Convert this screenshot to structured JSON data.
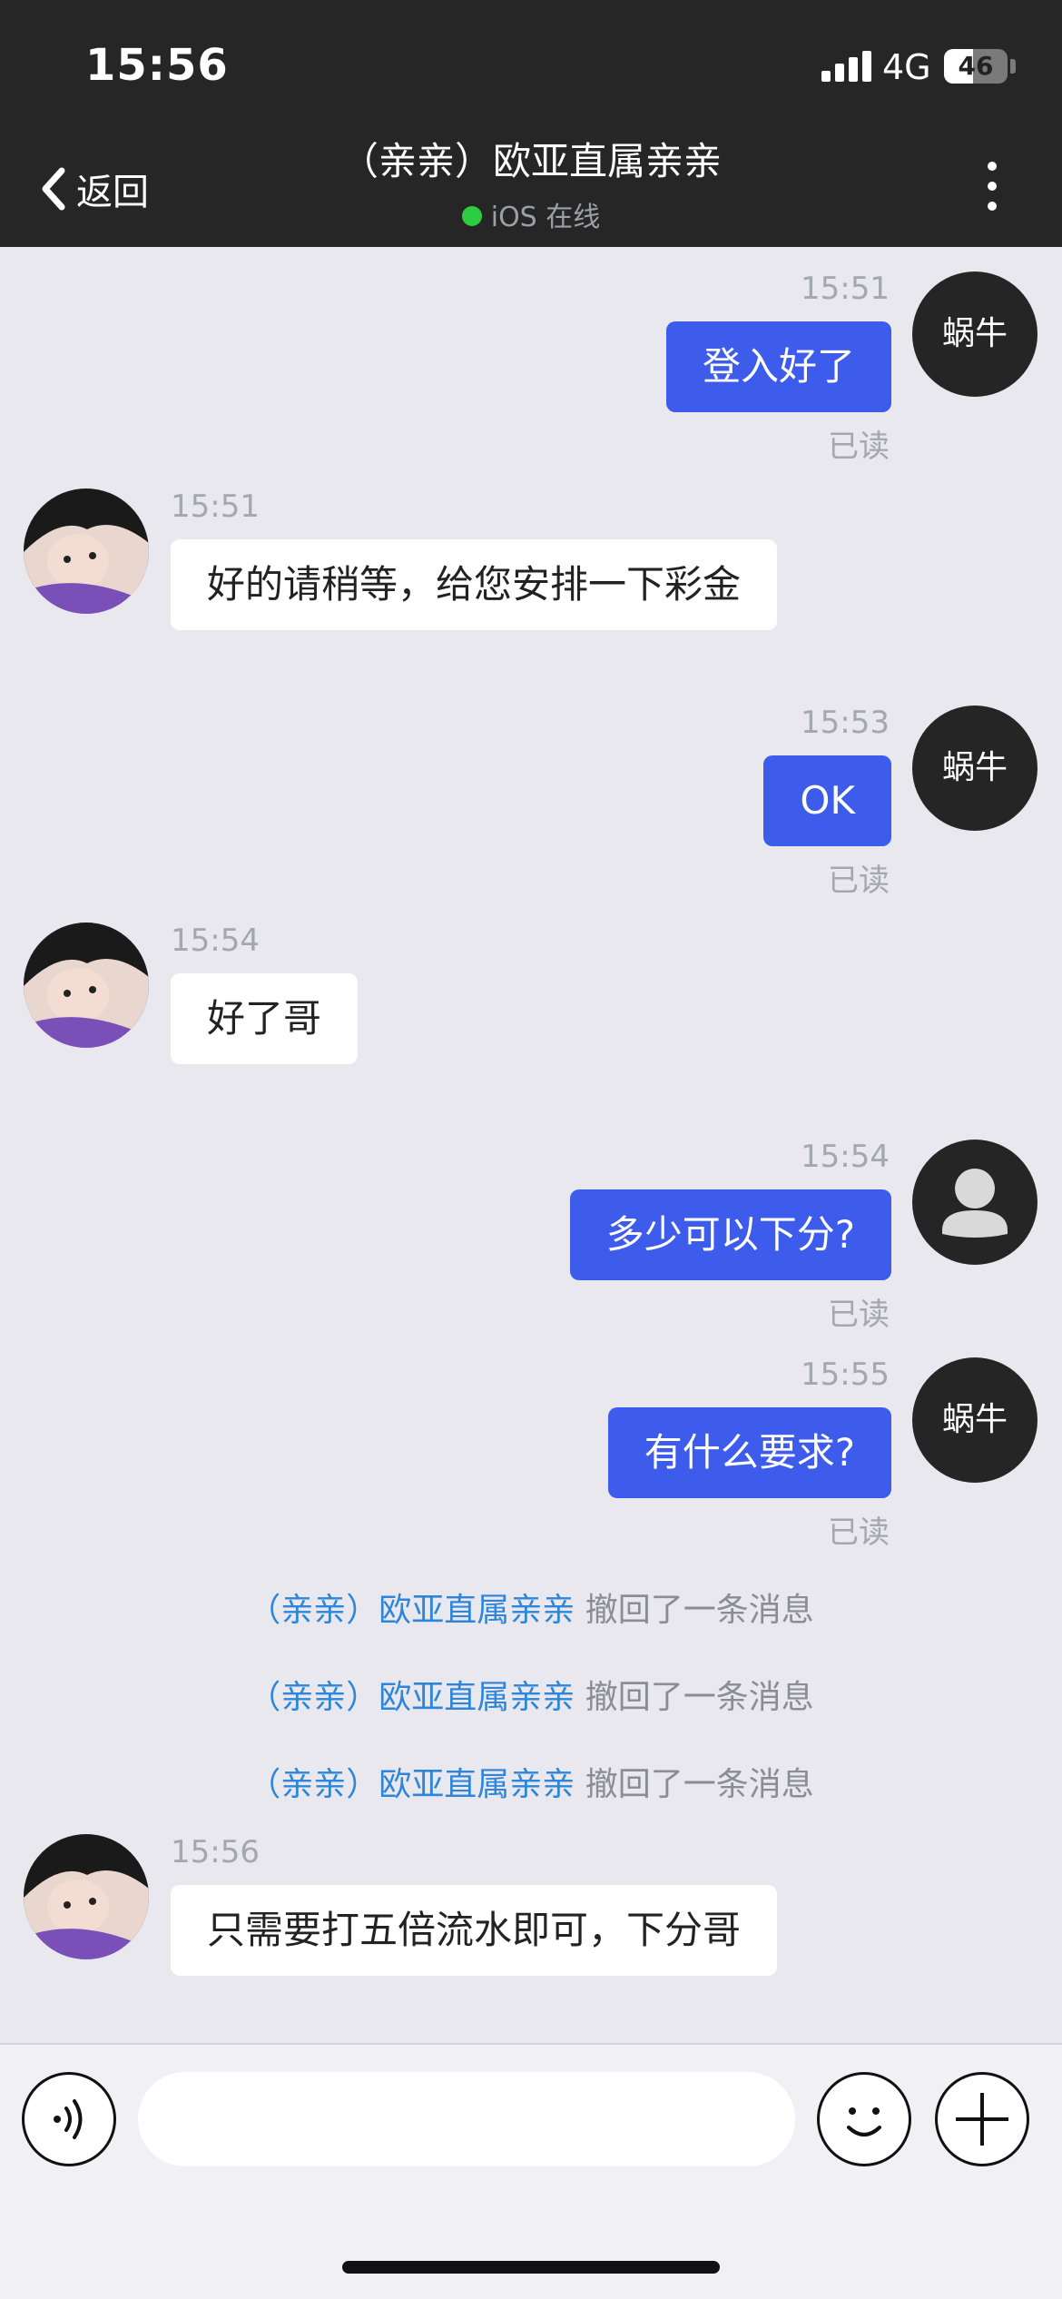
{
  "status_bar": {
    "time": "15:56",
    "network": "4G",
    "battery": "46",
    "battery_level": 0.46
  },
  "header": {
    "back_label": "返回",
    "title": "（亲亲）欧亚直属亲亲",
    "status": "iOS 在线"
  },
  "messages": [
    {
      "time": "15:51",
      "text": "登入好了",
      "read": "已读",
      "avatar_label": "蜗牛"
    },
    {
      "time": "15:51",
      "text": "好的请稍等，给您安排一下彩金"
    },
    {
      "time": "15:53",
      "text": "OK",
      "read": "已读",
      "avatar_label": "蜗牛"
    },
    {
      "time": "15:54",
      "text": "好了哥"
    },
    {
      "time": "15:54",
      "text": "多少可以下分?",
      "read": "已读"
    },
    {
      "time": "15:55",
      "text": "有什么要求?",
      "read": "已读",
      "avatar_label": "蜗牛"
    },
    {
      "time": "15:56",
      "text": "只需要打五倍流水即可，下分哥"
    }
  ],
  "recalls": [
    {
      "who": "（亲亲）欧亚直属亲亲",
      "text": "撤回了一条消息"
    },
    {
      "who": "（亲亲）欧亚直属亲亲",
      "text": "撤回了一条消息"
    },
    {
      "who": "（亲亲）欧亚直属亲亲",
      "text": "撤回了一条消息"
    }
  ],
  "input": {
    "value": "",
    "placeholder": ""
  },
  "icons": {
    "voice": "voice-icon",
    "emoji": "emoji-icon",
    "plus": "plus-icon",
    "back": "chevron-left-icon",
    "more": "more-vertical-icon"
  },
  "colors": {
    "outgoing_bubble": "#3d5ceb",
    "incoming_bubble": "#ffffff",
    "recall_name": "#2f86d9",
    "online_dot": "#2ecc40",
    "header_bg": "#262626"
  }
}
